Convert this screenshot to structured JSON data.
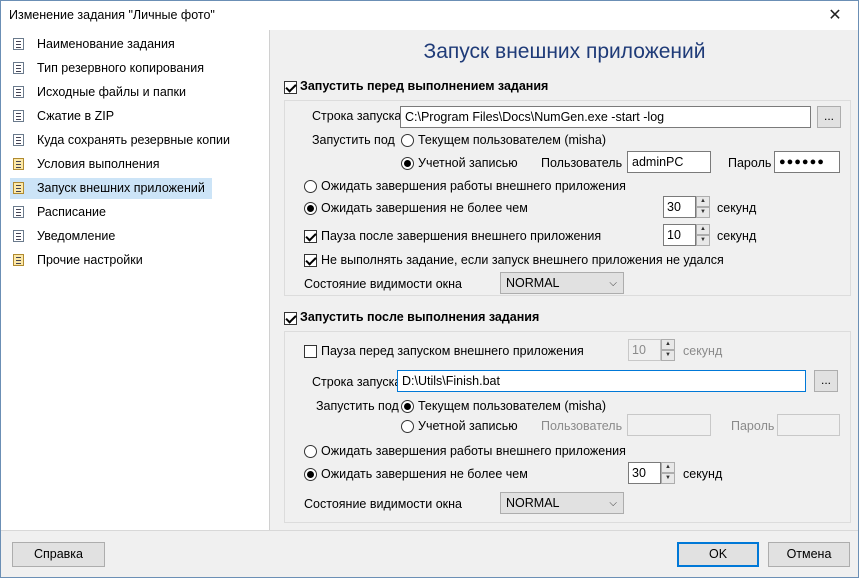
{
  "window": {
    "title": "Изменение задания \"Личные фото\"",
    "close": "✕"
  },
  "sidebar": {
    "items": [
      {
        "label": "Наименование задания"
      },
      {
        "label": "Тип резервного копирования"
      },
      {
        "label": "Исходные файлы и папки"
      },
      {
        "label": "Сжатие в ZIP"
      },
      {
        "label": "Куда сохранять резервные копии"
      },
      {
        "label": "Условия выполнения"
      },
      {
        "label": "Запуск внешних приложений"
      },
      {
        "label": "Расписание"
      },
      {
        "label": "Уведомление"
      },
      {
        "label": "Прочие настройки"
      }
    ]
  },
  "main": {
    "heading": "Запуск внешних приложений",
    "before": {
      "title": "Запустить перед выполнением задания",
      "cmd_label": "Строка запуска",
      "cmd_value": "C:\\Program Files\\Docs\\NumGen.exe -start -log",
      "browse": "...",
      "run_as_label": "Запустить под",
      "current_user": "Текущем пользователем (misha)",
      "account": "Учетной записью",
      "user_label": "Пользователь",
      "user_value": "adminPC",
      "pass_label": "Пароль",
      "pass_value": "●●●●●●",
      "wait_finish": "Ожидать завершения работы внешнего приложения",
      "wait_limit": "Ожидать завершения не более чем",
      "wait_seconds": "30",
      "seconds": "секунд",
      "pause_after": "Пауза после завершения внешнего приложения",
      "pause_seconds": "10",
      "no_run_on_fail": "Не выполнять задание, если запуск внешнего приложения не удался",
      "visibility_label": "Состояние видимости окна",
      "visibility_value": "NORMAL"
    },
    "after": {
      "title": "Запустить после выполнения задания",
      "pause_before": "Пауза перед запуском внешнего приложения",
      "pause_seconds": "10",
      "seconds": "секунд",
      "cmd_label": "Строка запуска",
      "cmd_value": "D:\\Utils\\Finish.bat",
      "browse": "...",
      "run_as_label": "Запустить под",
      "current_user": "Текущем пользователем (misha)",
      "account": "Учетной записью",
      "user_label": "Пользователь",
      "pass_label": "Пароль",
      "wait_finish": "Ожидать завершения работы внешнего приложения",
      "wait_limit": "Ожидать завершения не более чем",
      "wait_seconds": "30",
      "visibility_label": "Состояние видимости окна",
      "visibility_value": "NORMAL"
    }
  },
  "footer": {
    "help": "Справка",
    "ok": "OK",
    "cancel": "Отмена"
  },
  "colors": {
    "accent": "#0078d7",
    "heading": "#1f3b78",
    "selection": "#cce4f7"
  }
}
